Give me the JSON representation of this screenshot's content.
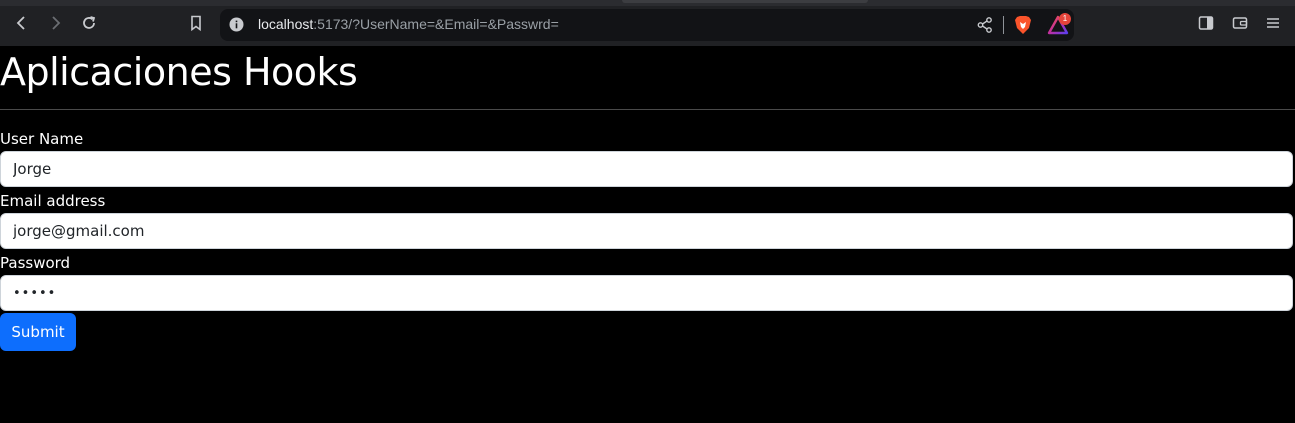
{
  "browser": {
    "url_host": "localhost",
    "url_rest": ":5173/?UserName=&Email=&Passwrd=",
    "rewards_badge": "1"
  },
  "page": {
    "title": "Aplicaciones Hooks"
  },
  "form": {
    "username_label": "User Name",
    "username_value": "Jorge",
    "email_label": "Email address",
    "email_value": "jorge@gmail.com",
    "password_label": "Password",
    "password_value": "•••••",
    "submit_label": "Submit"
  },
  "colors": {
    "background": "#000000",
    "submit": "#0d6efd",
    "toolbar": "#202124"
  },
  "icons": [
    "back-icon",
    "forward-icon",
    "reload-icon",
    "bookmark-icon",
    "info-icon",
    "share-icon",
    "brave-shields-icon",
    "brave-rewards-icon",
    "sidebar-icon",
    "wallet-icon",
    "menu-icon"
  ]
}
